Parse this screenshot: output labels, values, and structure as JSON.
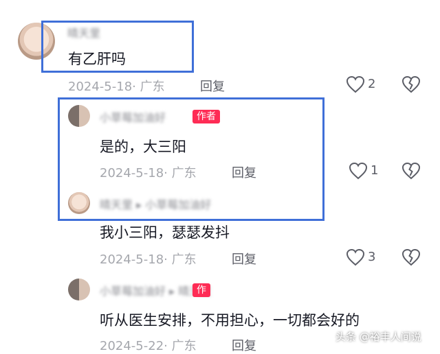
{
  "comments": [
    {
      "username": "晴天里",
      "text": "有乙肝吗",
      "meta": "2024-5-18· 广东",
      "reply_label": "回复",
      "likes": "2"
    },
    {
      "username": "小草莓加油好",
      "badge": "作者",
      "text": "是的，大三阳",
      "meta": "2024-5-18· 广东",
      "reply_label": "回复",
      "likes": "1"
    },
    {
      "username": "晴天里 ▸ 小草莓加油好",
      "text": "我小三阳，瑟瑟发抖",
      "meta": "2024-5-18· 广东",
      "reply_label": "回复",
      "likes": "3"
    },
    {
      "username": "小草莓加油好 ▸ 晴天里",
      "badge": "作",
      "text": "听从医生安排，不用担心，一切都会好的",
      "meta": "2024-5-22· 广东",
      "reply_label": "回复"
    }
  ],
  "watermark": "头条 @裕丰人间说",
  "colors": {
    "highlight_box": "#3f6fd8",
    "author_badge": "#fe2c55"
  }
}
